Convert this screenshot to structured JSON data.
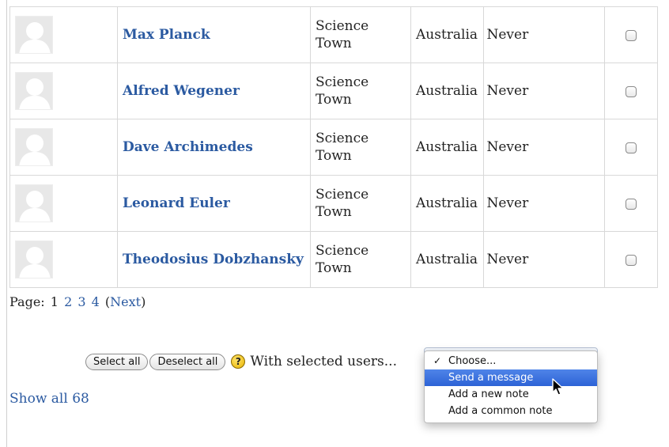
{
  "table": {
    "rows": [
      {
        "name": "Max Planck",
        "city": "Science Town",
        "country": "Australia",
        "last_access": "Never"
      },
      {
        "name": "Alfred Wegener",
        "city": "Science Town",
        "country": "Australia",
        "last_access": "Never"
      },
      {
        "name": "Dave Archimedes",
        "city": "Science Town",
        "country": "Australia",
        "last_access": "Never"
      },
      {
        "name": "Leonard Euler",
        "city": "Science Town",
        "country": "Australia",
        "last_access": "Never"
      },
      {
        "name": "Theodosius Dobzhansky",
        "city": "Science Town",
        "country": "Australia",
        "last_access": "Never"
      }
    ]
  },
  "paging": {
    "label": "Page:",
    "current": "1",
    "pages": [
      "2",
      "3",
      "4"
    ],
    "next_open": "(",
    "next_label": "Next",
    "next_close": ")"
  },
  "actions": {
    "select_all_label": "Select all",
    "deselect_all_label": "Deselect all",
    "help_symbol": "?",
    "with_selected_label": "With selected users..."
  },
  "dropdown": {
    "options": [
      {
        "label": "Choose...",
        "checked": true,
        "highlighted": false
      },
      {
        "label": "Send a message",
        "checked": false,
        "highlighted": true
      },
      {
        "label": "Add a new note",
        "checked": false,
        "highlighted": false
      },
      {
        "label": "Add a common note",
        "checked": false,
        "highlighted": false
      }
    ],
    "check_mark": "✓"
  },
  "show_all": {
    "label": "Show all 68"
  },
  "colors": {
    "link": "#2b5aa1",
    "highlight": "#3a6fde",
    "border": "#d8d8d8"
  }
}
